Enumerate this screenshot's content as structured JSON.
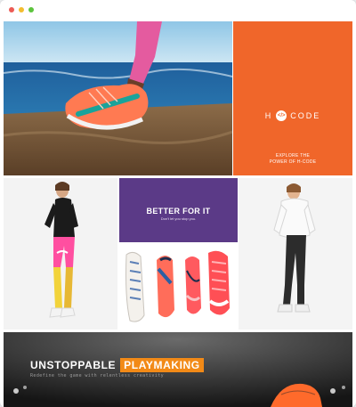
{
  "window": {
    "controls": [
      "close",
      "minimize",
      "maximize"
    ]
  },
  "colors": {
    "brand_orange": "#f0662a",
    "panel_purple": "#5b3a87",
    "banner_accent": "#f28a17"
  },
  "hero": {
    "image": "running-shoe-photo"
  },
  "brand_tile": {
    "logo_left": "H",
    "logo_mark": "</>",
    "logo_right": "CODE",
    "caption_line1": "EXPLORE THE",
    "caption_line2": "POWER OF H-CODE"
  },
  "better_tile": {
    "title": "BETTER FOR IT",
    "subtitle": "Don't let you stop you."
  },
  "banner": {
    "title_word": "UNSTOPPABLE",
    "title_highlight": "PLAYMAKING",
    "tagline": "Redefine the game with relentless creativity"
  }
}
